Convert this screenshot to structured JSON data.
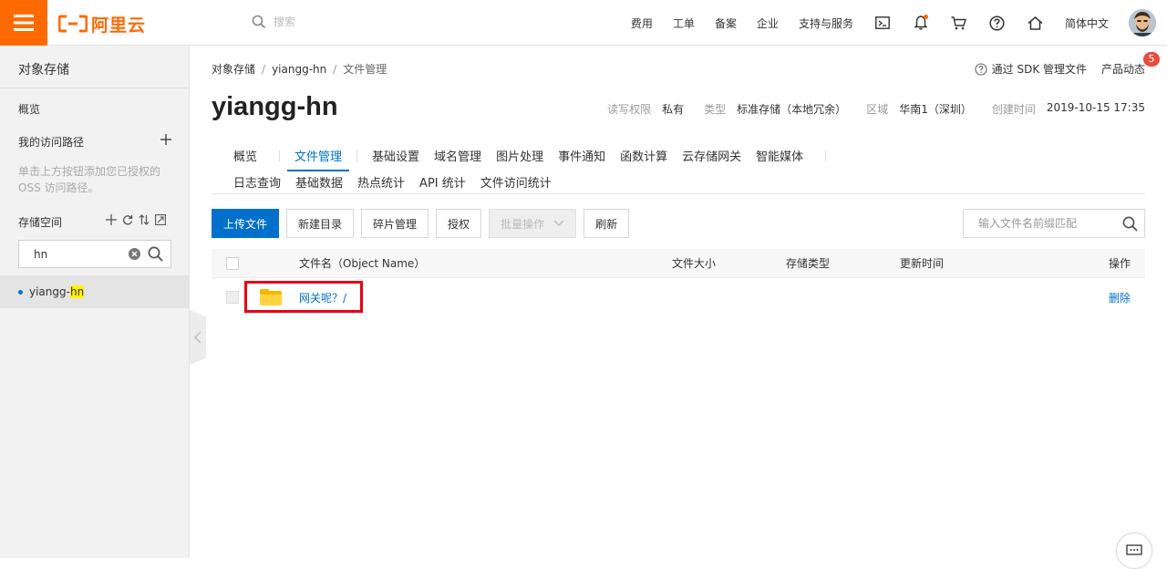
{
  "header": {
    "logo_text": "阿里云",
    "search_placeholder": "搜索",
    "nav": [
      "费用",
      "工单",
      "备案",
      "企业",
      "支持与服务"
    ],
    "language": "简体中文",
    "accent_color": "#ff6a00"
  },
  "sidebar": {
    "title": "对象存储",
    "overview": "概览",
    "access_paths": "我的访问路径",
    "hint": "单击上方按钮添加您已授权的 OSS 访问路径。",
    "buckets_label": "存储空间",
    "filter_value": "hn",
    "bucket_prefix": "yiangg-",
    "bucket_match": "hn"
  },
  "main": {
    "breadcrumb": [
      "对象存储",
      "yiangg-hn",
      "文件管理"
    ],
    "sdk_link": "通过 SDK 管理文件",
    "product_news": "产品动态",
    "news_count": "5",
    "bucket_name": "yiangg-hn",
    "meta": {
      "acl_label": "读写权限",
      "acl_value": "私有",
      "type_label": "类型",
      "type_value": "标准存储（本地冗余）",
      "region_label": "区域",
      "region_value": "华南1（深圳）",
      "created_label": "创建时间",
      "created_value": "2019-10-15 17:35"
    },
    "tabs_row1": [
      "概览",
      "文件管理",
      "基础设置",
      "域名管理",
      "图片处理",
      "事件通知",
      "函数计算",
      "云存储网关",
      "智能媒体"
    ],
    "tabs_row2": [
      "日志查询",
      "基础数据",
      "热点统计",
      "API 统计",
      "文件访问统计"
    ],
    "toolbar": {
      "upload": "上传文件",
      "new_dir": "新建目录",
      "fragments": "碎片管理",
      "authorize": "授权",
      "batch": "批量操作",
      "refresh": "刷新",
      "search_placeholder": "输入文件名前缀匹配"
    },
    "table": {
      "col_name": "文件名（Object Name）",
      "col_size": "文件大小",
      "col_storage": "存储类型",
      "col_updated": "更新时间",
      "col_actions": "操作",
      "rows": [
        {
          "name": "网关呢？/",
          "action": "删除"
        }
      ]
    }
  }
}
